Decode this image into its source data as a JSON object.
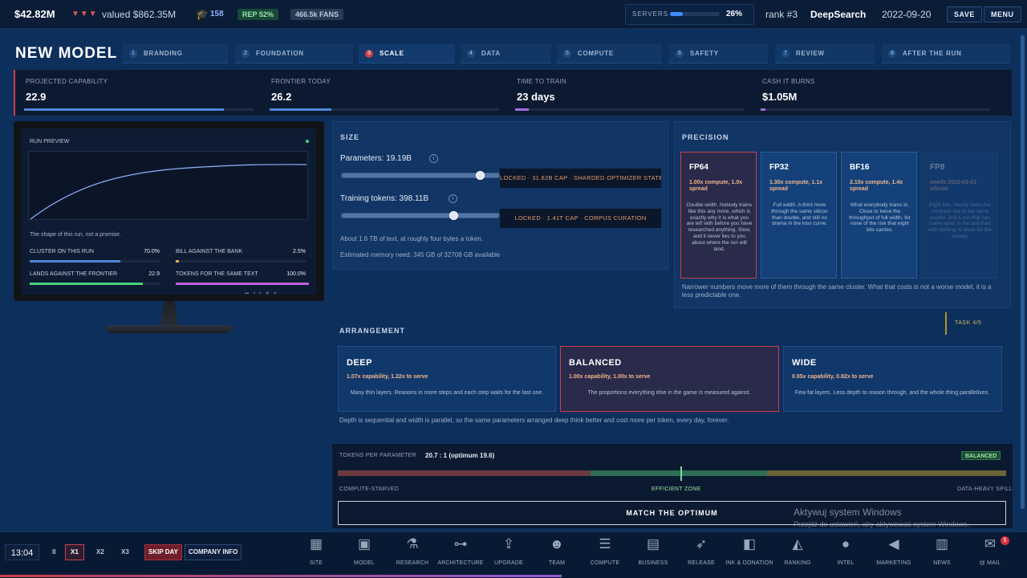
{
  "topbar": {
    "cash": "$42.82M",
    "trend": "▼▼▼",
    "valued": "valued $862.35M",
    "staff": "158",
    "rep": "REP 52%",
    "fans": "466.5k FANS",
    "servers_label": "SERVERS",
    "servers_pct": "26%",
    "servers_fill": 0.26,
    "rank": "rank #3",
    "company": "DeepSearch",
    "date": "2022-09-20",
    "save": "SAVE",
    "menu": "MENU",
    "icon": "graduation-cap-icon"
  },
  "page_title": "NEW MODEL",
  "steps": [
    {
      "num": "1",
      "label": "BRANDING"
    },
    {
      "num": "2",
      "label": "FOUNDATION"
    },
    {
      "num": "3",
      "label": "SCALE"
    },
    {
      "num": "4",
      "label": "DATA"
    },
    {
      "num": "5",
      "label": "COMPUTE"
    },
    {
      "num": "6",
      "label": "SAFETY"
    },
    {
      "num": "7",
      "label": "REVIEW"
    },
    {
      "num": "8",
      "label": "AFTER THE RUN"
    }
  ],
  "stats": [
    {
      "label": "PROJECTED CAPABILITY",
      "value": "22.9",
      "fill": 0.87,
      "color": "#4f86d8"
    },
    {
      "label": "FRONTIER TODAY",
      "value": "26.2",
      "fill": 0.27,
      "color": "#4f86d8"
    },
    {
      "label": "TIME TO TRAIN",
      "value": "23 days",
      "fill": 0.06,
      "color": "#a06ee0"
    },
    {
      "label": "CASH IT BURNS",
      "value": "$1.05M",
      "fill": 0.02,
      "color": "#a06ee0"
    }
  ],
  "preview": {
    "title": "RUN PREVIEW",
    "caption": "The shape of this run, not a promise.",
    "metrics": [
      {
        "label": "CLUSTER ON THIS RUN",
        "value": "70.0%",
        "fill": 0.7,
        "color": "#4f86d8"
      },
      {
        "label": "BILL AGAINST THE BANK",
        "value": "2.5%",
        "fill": 0.025,
        "color": "#e3b04b"
      },
      {
        "label": "LANDS AGAINST THE FRONTIER",
        "value": "22.9",
        "fill": 0.87,
        "color": "#4ad27e"
      },
      {
        "label": "TOKENS FOR THE SAME TEXT",
        "value": "100.0%",
        "fill": 1.0,
        "color": "#c060e0"
      }
    ]
  },
  "size": {
    "title": "SIZE",
    "params_label": "Parameters: 19.19B",
    "params_fill": 0.61,
    "params_locked": "LOCKED · 31.62B CAP · SHARDED OPTIMIZER STATE",
    "tokens_label": "Training tokens: 398.11B",
    "tokens_fill": 0.28,
    "tokens_locked": "LOCKED · 1.41T CAP · CORPUS CURATION",
    "text_hint": "About 1.6 TB of text, at roughly four bytes a token.",
    "memory_hint": "Estimated memory need: 345 GB of 32708 GB available",
    "info_glyph": "i"
  },
  "precision": {
    "title": "PRECISION",
    "cards": [
      {
        "name": "FP64",
        "cost": "1.00x compute, 1.0x spread",
        "desc": "Double width. Nobody trains like this any more, which is exactly why it is what you are left with before you have researched anything. Slow, and it never lies to you about where the run will land."
      },
      {
        "name": "FP32",
        "cost": "1.30x compute, 1.1x spread",
        "desc": "Full width. A third more through the same silicon than double, and still no drama in the loss curve."
      },
      {
        "name": "BF16",
        "cost": "2.10x compute, 1.4x spread",
        "desc": "What everybody trains in. Close to twice the throughput of full width, for none of the risk that eight bits carries."
      },
      {
        "name": "FP8",
        "cost": "needs 2023-03-01 silicon",
        "desc": "Eight bits. Nearly twice the compute out of the same cluster, and a run that can come apart in the last third with nothing to show for the money."
      }
    ],
    "note": "Narrower numbers move more of them through the same cluster. What that costs is not a worse model, it is a less predictable one."
  },
  "task": "TASK 4/5",
  "arrangement": {
    "title": "ARRANGEMENT",
    "cards": [
      {
        "name": "DEEP",
        "cost": "1.07x capability, 1.22x to serve",
        "desc": "Many thin layers. Reasons in more steps and each step waits for the last one."
      },
      {
        "name": "BALANCED",
        "cost": "1.00x capability, 1.00x to serve",
        "desc": "The proportions everything else in the game is measured against."
      },
      {
        "name": "WIDE",
        "cost": "0.95x capability, 0.82x to serve",
        "desc": "Few fat layers. Less depth to reason through, and the whole thing parallelises."
      }
    ],
    "note": "Depth is sequential and width is parallel, so the same parameters arranged deep think better and cost more per token, every day, forever."
  },
  "tpp": {
    "label": "TOKENS PER PARAMETER",
    "value": "20.7 : 1 (optimum 19.6)",
    "badge": "BALANCED",
    "zone_left": "COMPUTE-STARVED",
    "zone_mid": "EFFICIENT ZONE",
    "zone_right": "DATA-HEAVY SPILL",
    "match": "MATCH THE OPTIMUM"
  },
  "watermark": {
    "line1": "Aktywuj system Windows",
    "line2": "Przejdź do ustawień, aby aktywować system Windows."
  },
  "bottom": {
    "clock": "13:04",
    "pause": "II",
    "x1": "X1",
    "x2": "X2",
    "x3": "X3",
    "skip": "SKIP DAY",
    "company_info": "COMPANY INFO",
    "mail_count": "5",
    "nav": [
      {
        "label": "SITE",
        "icon": "building-icon"
      },
      {
        "label": "MODEL",
        "icon": "chip-icon"
      },
      {
        "label": "RESEARCH",
        "icon": "microscope-icon"
      },
      {
        "label": "ARCHITECTURE",
        "icon": "hierarchy-icon"
      },
      {
        "label": "UPGRADE",
        "icon": "upgrade-icon"
      },
      {
        "label": "TEAM",
        "icon": "team-icon"
      },
      {
        "label": "COMPUTE",
        "icon": "server-icon"
      },
      {
        "label": "BUSINESS",
        "icon": "briefcase-icon"
      },
      {
        "label": "RELEASE",
        "icon": "rocket-icon"
      },
      {
        "label": "INK & DONATION",
        "icon": "donation-icon"
      },
      {
        "label": "RANKING",
        "icon": "ranking-icon"
      },
      {
        "label": "INTEL",
        "icon": "globe-icon"
      },
      {
        "label": "MARKETING",
        "icon": "megaphone-icon"
      },
      {
        "label": "NEWS",
        "icon": "newspaper-icon"
      },
      {
        "label": "@ MAIL",
        "icon": "mail-icon"
      }
    ]
  }
}
